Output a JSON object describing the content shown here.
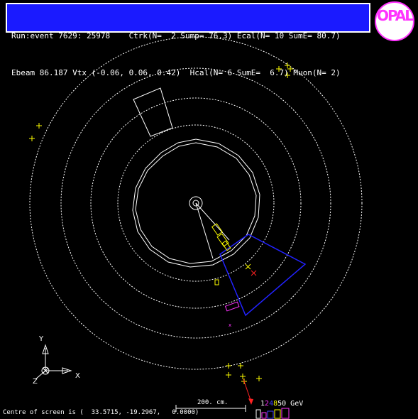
{
  "header": {
    "line1": "Run:event 7629: 25978    Ctrk(N=  2 Sump= 76.3) Ecal(N= 10 SumE= 80.7)",
    "line2": "Ebeam 86.187 Vtx (-0.06, 0.06, 0.42)  Hcal(N= 6 SumE=  6.7) Muon(N= 2)"
  },
  "logo": {
    "text": "OPAL"
  },
  "axes": {
    "x": "X",
    "y": "Y",
    "z": "Z"
  },
  "scale": {
    "label": "200. cm."
  },
  "energy_scale": {
    "values": [
      "1",
      "2",
      "4",
      "8",
      "50 GeV"
    ],
    "colors": [
      "#ffffff",
      "#ff33ff",
      "#4444ff",
      "#ffff00",
      "#ffffff"
    ]
  },
  "footer": {
    "text": "Centre of screen is (  33.5715, -19.2967,   0.0000)"
  },
  "colors": {
    "header_bg": "#1a1aff",
    "detector": "#ffffff",
    "track": "#ffffff",
    "ecal": "#ffff00",
    "hcal": "#0000ff",
    "muon": "#ff2222",
    "magenta": "#ff33ff"
  }
}
